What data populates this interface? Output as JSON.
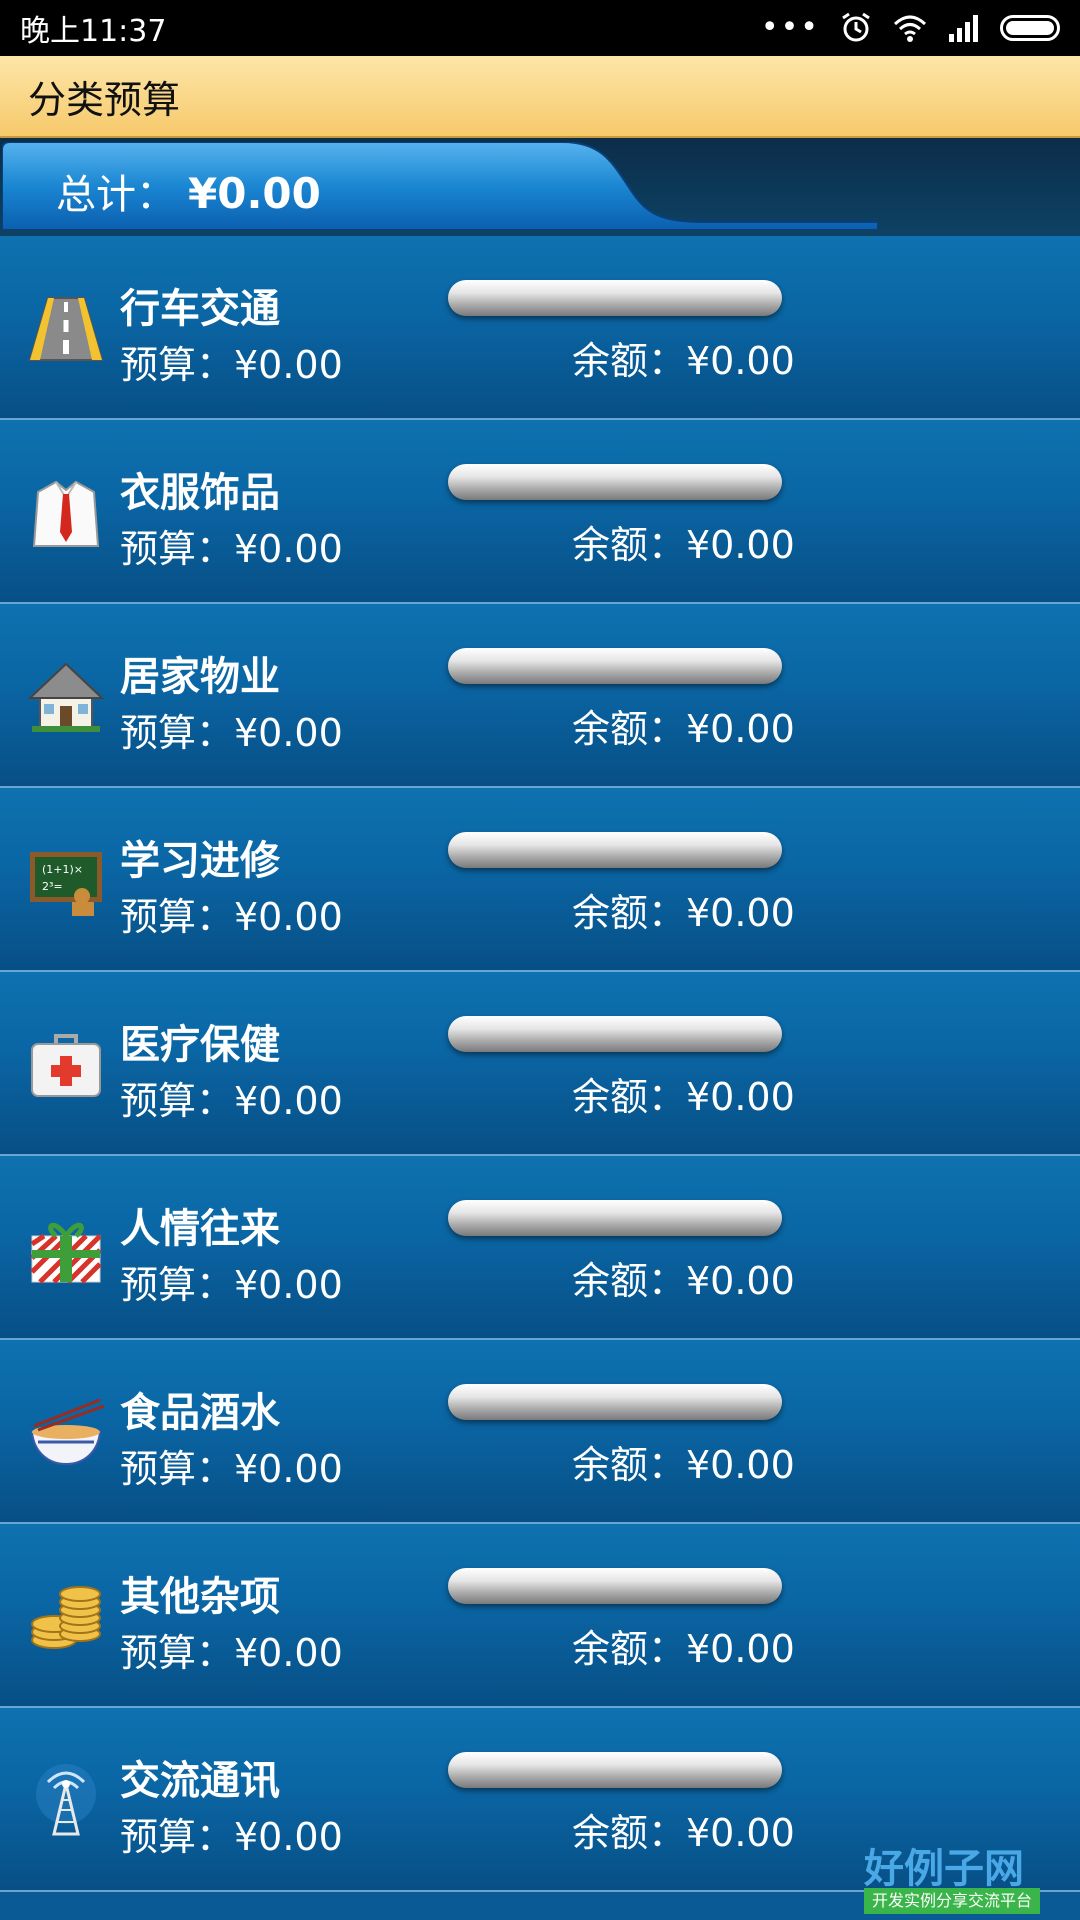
{
  "status_bar": {
    "time": "晚上11:37",
    "dots": "•••",
    "icons": [
      "alarm-icon",
      "wifi-icon",
      "signal-icon",
      "battery-icon"
    ]
  },
  "title_bar": {
    "title": "分类预算"
  },
  "summary": {
    "label": "总计：",
    "amount": "¥0.00"
  },
  "budget_items": [
    {
      "icon": "road-icon",
      "name": "行车交通",
      "budget": "预算：¥0.00",
      "balance": "余额：¥0.00",
      "progress": 0
    },
    {
      "icon": "shirt-tie-icon",
      "name": "衣服饰品",
      "budget": "预算：¥0.00",
      "balance": "余额：¥0.00",
      "progress": 0
    },
    {
      "icon": "house-icon",
      "name": "居家物业",
      "budget": "预算：¥0.00",
      "balance": "余额：¥0.00",
      "progress": 0
    },
    {
      "icon": "chalkboard-icon",
      "name": "学习进修",
      "budget": "预算：¥0.00",
      "balance": "余额：¥0.00",
      "progress": 0
    },
    {
      "icon": "first-aid-kit-icon",
      "name": "医疗保健",
      "budget": "预算：¥0.00",
      "balance": "余额：¥0.00",
      "progress": 0
    },
    {
      "icon": "gift-icon",
      "name": "人情往来",
      "budget": "预算：¥0.00",
      "balance": "余额：¥0.00",
      "progress": 0
    },
    {
      "icon": "noodle-bowl-icon",
      "name": "食品酒水",
      "budget": "预算：¥0.00",
      "balance": "余额：¥0.00",
      "progress": 0
    },
    {
      "icon": "coins-icon",
      "name": "其他杂项",
      "budget": "预算：¥0.00",
      "balance": "余额：¥0.00",
      "progress": 0
    },
    {
      "icon": "antenna-tower-icon",
      "name": "交流通讯",
      "budget": "预算：¥0.00",
      "balance": "余额：¥0.00",
      "progress": 0
    }
  ],
  "watermark": {
    "title": "好例子网",
    "subtitle": "开发实例分享交流平台"
  },
  "colors": {
    "title_bar": "#f6c96b",
    "row_background": "#0a65a3",
    "divider": "#6aa6cf"
  }
}
